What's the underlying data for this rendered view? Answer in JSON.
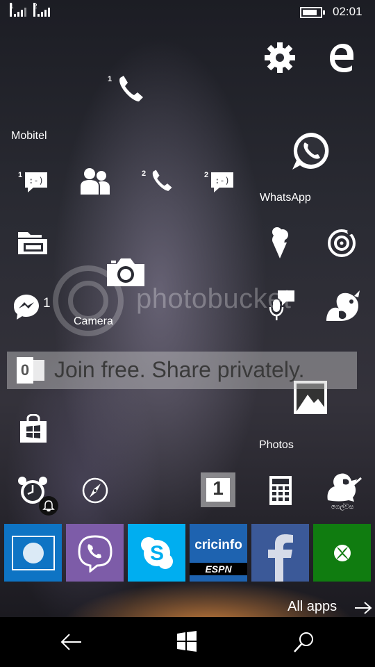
{
  "status": {
    "signal1_label": "1",
    "signal2_label": "2",
    "time": "02:01",
    "battery_icon": "battery-icon"
  },
  "tiles": {
    "phone1_badge": "1",
    "carrier_label": "Mobitel",
    "msg1_badge": "1",
    "phone2_badge": "2",
    "msg2_badge": "2",
    "whatsapp_label": "WhatsApp",
    "camera_label": "Camera",
    "messenger_count": "1",
    "photos_label": "Photos",
    "calendar_day": "1",
    "lion_text": "ගෙල්වස",
    "cricinfo_label": "cricinfo",
    "espn_label": "ESPN"
  },
  "watermark": {
    "brand": "photobucket",
    "tagline": "Join free. Share privately."
  },
  "footer": {
    "all_apps_label": "All apps"
  },
  "colors": {
    "english_tile": "#0e74c4",
    "viber_tile": "#7d5ca8",
    "skype_tile": "#00aef0",
    "cricinfo_tile": "#1e63b0",
    "facebook_tile": "#3b5998",
    "xbox_tile": "#107c10"
  }
}
